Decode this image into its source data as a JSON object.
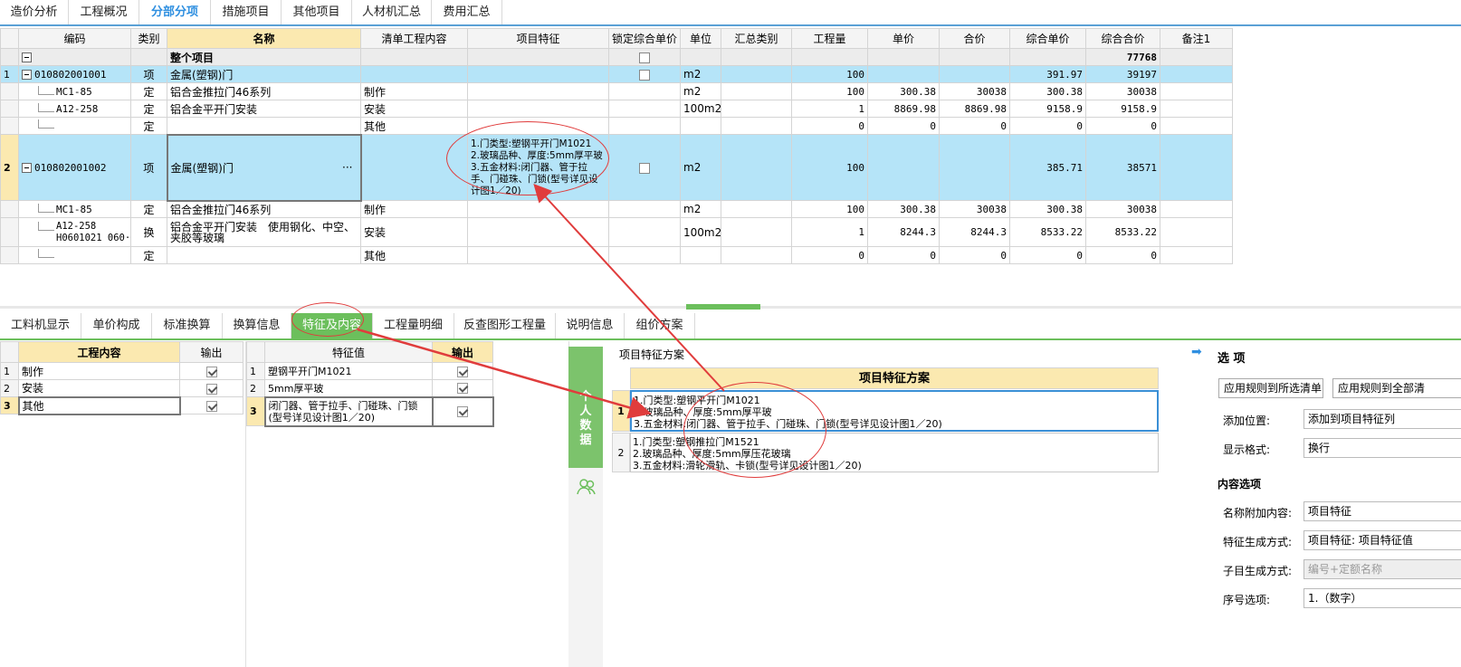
{
  "top_tabs": [
    "造价分析",
    "工程概况",
    "分部分项",
    "措施项目",
    "其他项目",
    "人材机汇总",
    "费用汇总"
  ],
  "top_tabs_active": "分部分项",
  "main_table": {
    "headers": [
      "编码",
      "类别",
      "名称",
      "清单工程内容",
      "项目特征",
      "锁定综合单价",
      "单位",
      "汇总类别",
      "工程量",
      "单价",
      "合价",
      "综合单价",
      "综合合价",
      "备注1"
    ],
    "total_row": {
      "name": "整个项目",
      "total": "77768"
    },
    "rows": [
      {
        "idx": "1",
        "code": "010802001001",
        "type": "项",
        "name": "金属(塑钢)门",
        "content": "",
        "feature": "",
        "lock": true,
        "unit": "m2",
        "cat": "",
        "qty": "100",
        "price": "",
        "amount": "",
        "cprice": "391.97",
        "camount": "39197",
        "note": ""
      },
      {
        "idx": "",
        "code": "MC1-85",
        "type": "定",
        "name": "铝合金推拉门46系列",
        "content": "制作",
        "feature": "",
        "unit": "m2",
        "cat": "",
        "qty": "100",
        "price": "300.38",
        "amount": "30038",
        "cprice": "300.38",
        "camount": "30038",
        "note": ""
      },
      {
        "idx": "",
        "code": "A12-258",
        "type": "定",
        "name": "铝合金平开门安装",
        "content": "安装",
        "feature": "",
        "unit": "100m2",
        "cat": "",
        "qty": "1",
        "price": "8869.98",
        "amount": "8869.98",
        "cprice": "9158.9",
        "camount": "9158.9",
        "note": ""
      },
      {
        "idx": "",
        "code": "",
        "type": "定",
        "name": "",
        "content": "其他",
        "feature": "",
        "unit": "",
        "cat": "",
        "qty": "0",
        "price": "0",
        "amount": "0",
        "cprice": "0",
        "camount": "0",
        "note": ""
      },
      {
        "idx": "2",
        "code": "010802001002",
        "type": "项",
        "name": "金属(塑钢)门",
        "name_more": "···",
        "content": "",
        "feature": "1.门类型:塑钢平开门M1021\n2.玻璃品种、厚度:5mm厚平玻\n3.五金材料:闭门器、管于拉手、门碰珠、门锁(型号详见设计图1／20)",
        "lock": true,
        "unit": "m2",
        "cat": "",
        "qty": "100",
        "price": "",
        "amount": "",
        "cprice": "385.71",
        "camount": "38571",
        "note": ""
      },
      {
        "idx": "",
        "code": "MC1-85",
        "type": "定",
        "name": "铝合金推拉门46系列",
        "content": "制作",
        "feature": "",
        "unit": "m2",
        "cat": "",
        "qty": "100",
        "price": "300.38",
        "amount": "30038",
        "cprice": "300.38",
        "camount": "30038",
        "note": ""
      },
      {
        "idx": "",
        "code": "A12-258\nH0601021 060···",
        "type": "换",
        "name": "铝合金平开门安装　使用钢化、中空、夹胶等玻璃",
        "content": "安装",
        "feature": "",
        "unit": "100m2",
        "cat": "",
        "qty": "1",
        "price": "8244.3",
        "amount": "8244.3",
        "cprice": "8533.22",
        "camount": "8533.22",
        "note": ""
      },
      {
        "idx": "",
        "code": "",
        "type": "定",
        "name": "",
        "content": "其他",
        "feature": "",
        "unit": "",
        "cat": "",
        "qty": "0",
        "price": "0",
        "amount": "0",
        "cprice": "0",
        "camount": "0",
        "note": ""
      }
    ]
  },
  "lower_tabs": [
    "工料机显示",
    "单价构成",
    "标准换算",
    "换算信息",
    "特征及内容",
    "工程量明细",
    "反查图形工程量",
    "说明信息",
    "组价方案"
  ],
  "lower_tabs_active": "特征及内容",
  "work_content": {
    "headers": [
      "工程内容",
      "输出"
    ],
    "rows": [
      {
        "idx": "1",
        "text": "制作",
        "out": true
      },
      {
        "idx": "2",
        "text": "安装",
        "out": true
      },
      {
        "idx": "3",
        "text": "其他",
        "out": true
      }
    ]
  },
  "feature_values": {
    "headers": [
      "特征值",
      "输出"
    ],
    "rows": [
      {
        "idx": "1",
        "text": "塑钢平开门M1021",
        "out": true
      },
      {
        "idx": "2",
        "text": "5mm厚平玻",
        "out": true
      },
      {
        "idx": "3",
        "text": "闭门器、管于拉手、门碰珠、门锁(型号详见设计图1／20)",
        "out": true
      }
    ]
  },
  "scheme_panel": {
    "title": "项目特征方案",
    "header": "项目特征方案",
    "side_label": "个人数据",
    "items": [
      {
        "idx": "1",
        "lines": [
          "1.门类型:塑钢平开门M1021",
          "2.玻璃品种、厚度:5mm厚平玻",
          "3.五金材料:闭门器、管于拉手、门碰珠、门锁(型号详见设计图1／20)"
        ]
      },
      {
        "idx": "2",
        "lines": [
          "1.门类型:塑钢推拉门M1521",
          "2.玻璃品种、厚度:5mm厚压花玻璃",
          "3.五金材料:滑轮滑轨、卡锁(型号详见设计图1／20)"
        ]
      }
    ]
  },
  "options": {
    "title": "选 项",
    "btn_apply_selected": "应用规则到所选清单",
    "btn_apply_all": "应用规则到全部清",
    "add_pos_label": "添加位置:",
    "add_pos_value": "添加到项目特征列",
    "format_label": "显示格式:",
    "format_value": "换行",
    "content_section": "内容选项",
    "name_add_label": "名称附加内容:",
    "name_add_value": "项目特征",
    "feature_gen_label": "特征生成方式:",
    "feature_gen_value": "项目特征: 项目特征值",
    "sub_gen_label": "子目生成方式:",
    "sub_gen_value": "编号+定额名称",
    "seq_label": "序号选项:",
    "seq_value": "1.（数字）"
  },
  "colors": {
    "accent_blue": "#2f8fe0",
    "green": "#6cbf5c",
    "row_highlight": "#b5e4f8",
    "header_yellow": "#fbe9b0",
    "annotation_red": "#e03c3c"
  }
}
